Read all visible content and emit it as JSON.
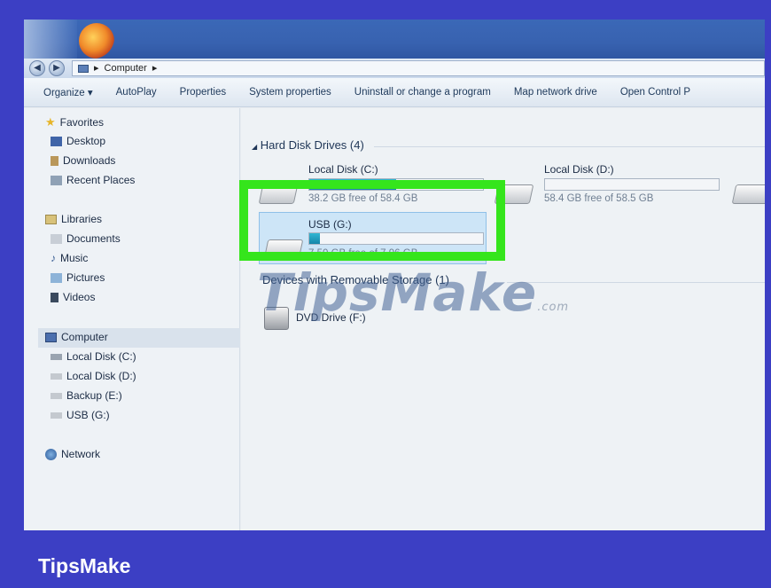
{
  "window": {
    "address": {
      "root_icon": "computer-icon",
      "path": [
        "Computer"
      ],
      "separator": "▸"
    }
  },
  "toolbar": {
    "organize": "Organize ▾",
    "autoplay": "AutoPlay",
    "properties": "Properties",
    "system_properties": "System properties",
    "uninstall": "Uninstall or change a program",
    "map_drive": "Map network drive",
    "control_panel": "Open Control P"
  },
  "sidebar": {
    "favorites": "Favorites",
    "desktop": "Desktop",
    "downloads": "Downloads",
    "recent": "Recent Places",
    "libraries": "Libraries",
    "documents": "Documents",
    "music": "Music",
    "pictures": "Pictures",
    "videos": "Videos",
    "computer": "Computer",
    "local_c": "Local Disk (C:)",
    "local_d": "Local Disk (D:)",
    "backup_e": "Backup (E:)",
    "usb_g": "USB (G:)",
    "network": "Network"
  },
  "main": {
    "hdd_header": "Hard Disk Drives (4)",
    "removable_header": "Devices with Removable Storage (1)",
    "drives": {
      "c": {
        "label": "Local Disk (C:)",
        "used_fraction": 0.5,
        "free_text": "38.2 GB free of 58.4 GB"
      },
      "d": {
        "label": "Local Disk (D:)",
        "used_fraction": 0.0,
        "free_text": "58.4 GB free of 58.5 GB"
      },
      "g": {
        "label": "USB (G:)",
        "used_fraction": 0.06,
        "free_text": "7.50 GB free of 7.96 GB"
      }
    },
    "dvd_label": "DVD Drive (F:)"
  },
  "watermark": {
    "text": "TipsMake",
    "domain": ".com"
  },
  "brand": "TipsMake",
  "colors": {
    "frame": "#3c3fc4",
    "highlight": "#35e51c",
    "bar_fill": "#1f9bbf"
  }
}
